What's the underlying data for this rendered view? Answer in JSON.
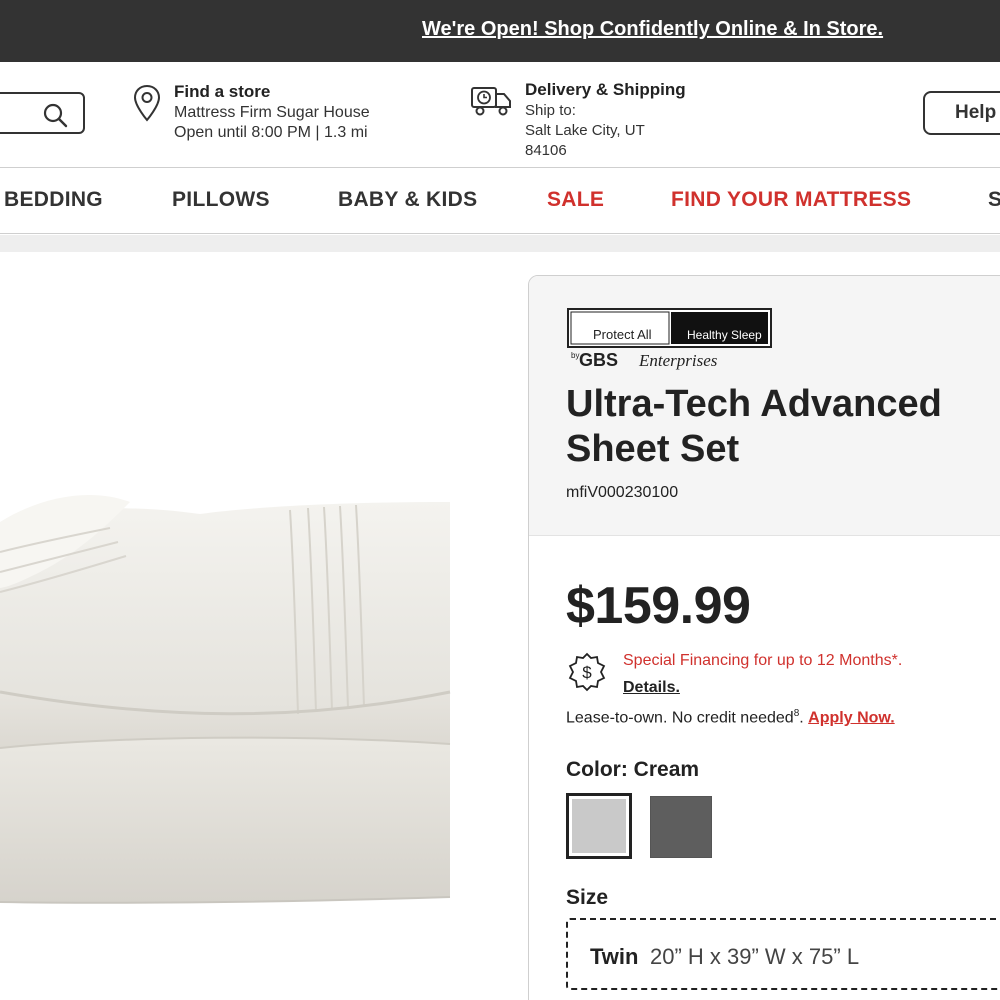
{
  "banner": {
    "text": "We're Open! Shop Confidently Online & In Store."
  },
  "header": {
    "search": {
      "icon": "search-icon"
    },
    "store": {
      "title": "Find a store",
      "name": "Mattress Firm Sugar House",
      "hours": "Open until 8:00 PM | 1.3 mi",
      "icon": "map-pin-icon"
    },
    "delivery": {
      "title": "Delivery & Shipping",
      "ship_to_label": "Ship to:",
      "city": "Salt Lake City, UT",
      "zip": "84106",
      "icon": "truck-icon"
    },
    "help_label": "Help"
  },
  "nav": {
    "items": [
      {
        "label": "BEDDING"
      },
      {
        "label": "PILLOWS"
      },
      {
        "label": "BABY & KIDS"
      },
      {
        "label": "SALE"
      },
      {
        "label": "FIND YOUR MATTRESS"
      },
      {
        "label": "S"
      }
    ],
    "accent_color": "#d0312d"
  },
  "product": {
    "brand": {
      "protect_all": "Protect All",
      "healthy_sleep": "Healthy Sleep",
      "by": "by",
      "gbs": "GBS",
      "enterprises": "Enterprises"
    },
    "title": "Ultra-Tech Advanced Sheet Set",
    "sku": "mfiV000230100",
    "price": "$159.99",
    "financing": {
      "text": "Special Financing for up to 12 Months*.",
      "details_label": "Details.",
      "icon": "dollar-badge-icon"
    },
    "lease": {
      "text": "Lease-to-own. No credit needed",
      "footnote": "8",
      "period": ".",
      "apply_label": "Apply Now."
    },
    "color": {
      "label": "Color:",
      "selected": "Cream",
      "options": [
        {
          "name": "Cream",
          "hex": "#c9c9c9"
        },
        {
          "name": "Gray",
          "hex": "#5e5e5e"
        }
      ]
    },
    "size": {
      "label": "Size",
      "selected_name": "Twin",
      "selected_dims": "20” H x 39” W x 75” L"
    }
  }
}
